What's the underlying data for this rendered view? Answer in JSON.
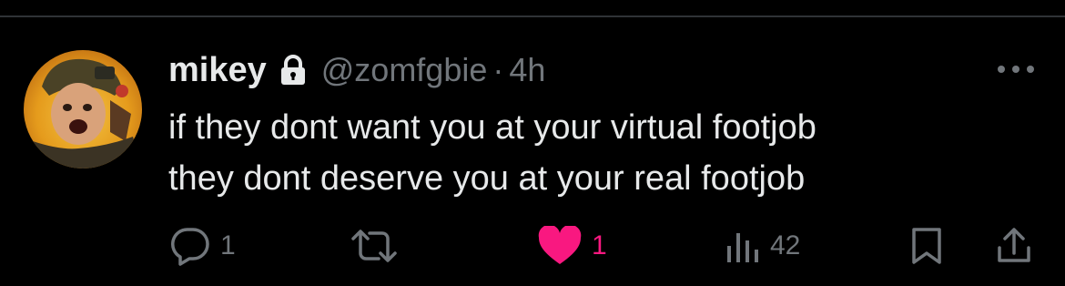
{
  "tweet": {
    "author_name": "mikey",
    "handle": "@zomfgbie",
    "separator": "·",
    "time": "4h",
    "text_lines": [
      "if they dont want you at your virtual footjob",
      "they dont deserve you at your real footjob"
    ],
    "protected": true
  },
  "actions": {
    "reply_count": "1",
    "retweet_count": "",
    "like_count": "1",
    "liked": true,
    "view_count": "42"
  },
  "colors": {
    "background": "#000000",
    "primary_text": "#e7e9ea",
    "secondary_text": "#71767b",
    "like_pink": "#f91880",
    "divider": "#2f3336"
  },
  "icons": {
    "lock": "lock-icon",
    "more": "more-horizontal-icon",
    "reply": "reply-icon",
    "retweet": "retweet-icon",
    "like": "heart-icon",
    "views": "views-chart-icon",
    "bookmark": "bookmark-icon",
    "share": "share-icon"
  }
}
